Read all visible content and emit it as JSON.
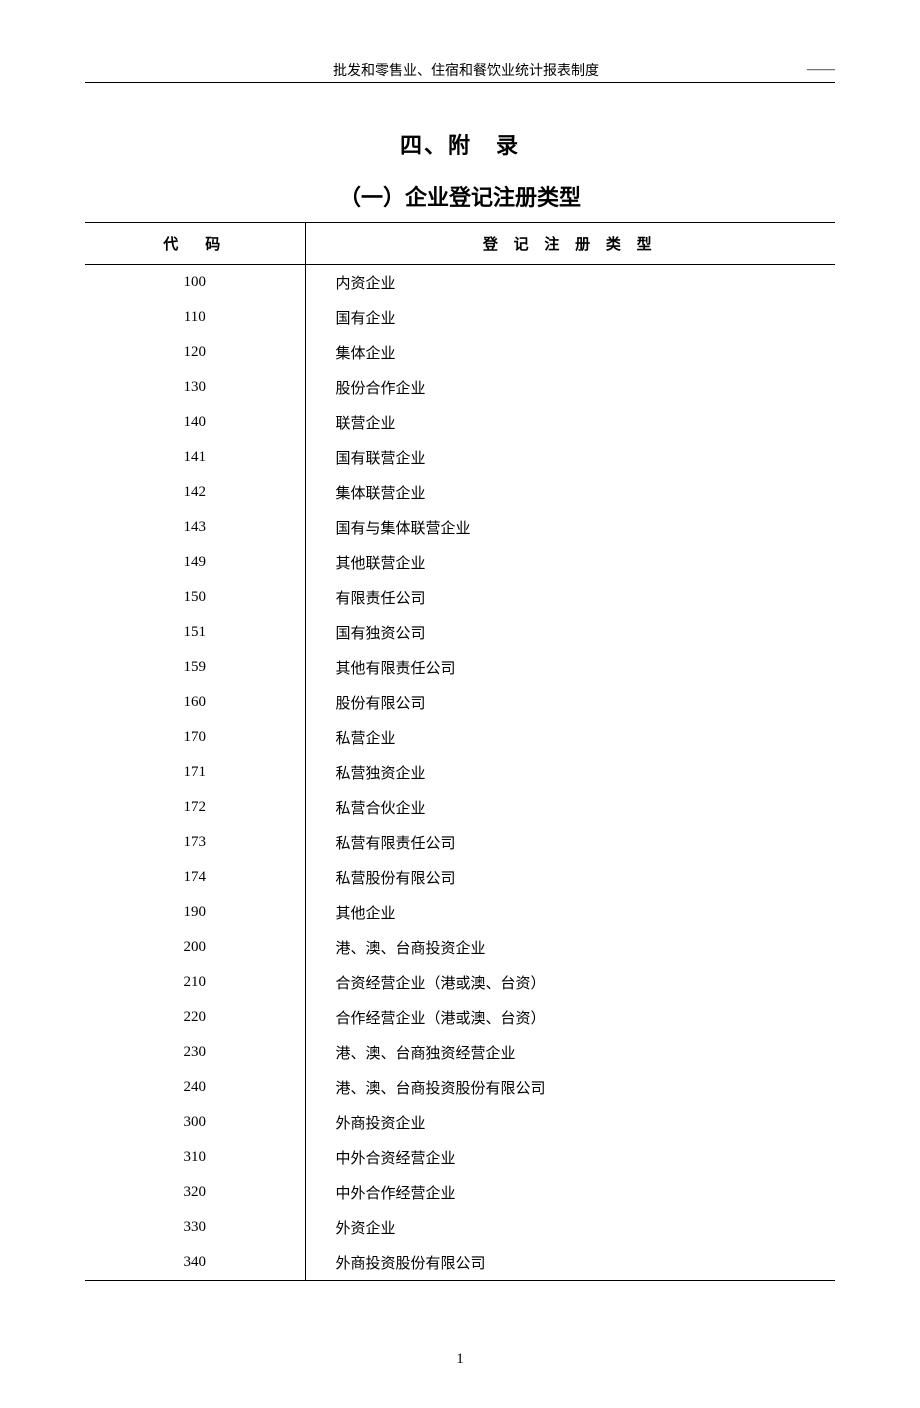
{
  "header": {
    "title": "批发和零售业、住宿和餐饮业统计报表制度",
    "right": "——"
  },
  "section_title": "四、附　录",
  "subsection_title": "（一）企业登记注册类型",
  "table": {
    "header": {
      "code": "代　码",
      "type": "登 记 注 册 类 型"
    },
    "rows": [
      {
        "code": "100",
        "type": "内资企业",
        "indent": 0
      },
      {
        "code": "110",
        "type": "国有企业",
        "indent": 1
      },
      {
        "code": "120",
        "type": "集体企业",
        "indent": 1
      },
      {
        "code": "130",
        "type": "股份合作企业",
        "indent": 1
      },
      {
        "code": "140",
        "type": "联营企业",
        "indent": 1
      },
      {
        "code": "141",
        "type": "国有联营企业",
        "indent": 2
      },
      {
        "code": "142",
        "type": "集体联营企业",
        "indent": 2
      },
      {
        "code": "143",
        "type": "国有与集体联营企业",
        "indent": 2
      },
      {
        "code": "149",
        "type": "其他联营企业",
        "indent": 2
      },
      {
        "code": "150",
        "type": "有限责任公司",
        "indent": 1
      },
      {
        "code": "151",
        "type": "国有独资公司",
        "indent": 2
      },
      {
        "code": "159",
        "type": "其他有限责任公司",
        "indent": 2
      },
      {
        "code": "160",
        "type": "股份有限公司",
        "indent": 1
      },
      {
        "code": "170",
        "type": "私营企业",
        "indent": 1
      },
      {
        "code": "171",
        "type": "私营独资企业",
        "indent": 2
      },
      {
        "code": "172",
        "type": "私营合伙企业",
        "indent": 2
      },
      {
        "code": "173",
        "type": "私营有限责任公司",
        "indent": 2
      },
      {
        "code": "174",
        "type": "私营股份有限公司",
        "indent": 2
      },
      {
        "code": "190",
        "type": "其他企业",
        "indent": 1
      },
      {
        "code": "200",
        "type": "港、澳、台商投资企业",
        "indent": 0
      },
      {
        "code": "210",
        "type": "合资经营企业（港或澳、台资）",
        "indent": 1
      },
      {
        "code": "220",
        "type": "合作经营企业（港或澳、台资）",
        "indent": 1
      },
      {
        "code": "230",
        "type": "港、澳、台商独资经营企业",
        "indent": 1
      },
      {
        "code": "240",
        "type": "港、澳、台商投资股份有限公司",
        "indent": 1
      },
      {
        "code": "300",
        "type": "外商投资企业",
        "indent": 0
      },
      {
        "code": "310",
        "type": "中外合资经营企业",
        "indent": 1
      },
      {
        "code": "320",
        "type": "中外合作经营企业",
        "indent": 1
      },
      {
        "code": "330",
        "type": "外资企业",
        "indent": 1
      },
      {
        "code": "340",
        "type": "外商投资股份有限公司",
        "indent": 1
      }
    ]
  },
  "page_number": "1"
}
